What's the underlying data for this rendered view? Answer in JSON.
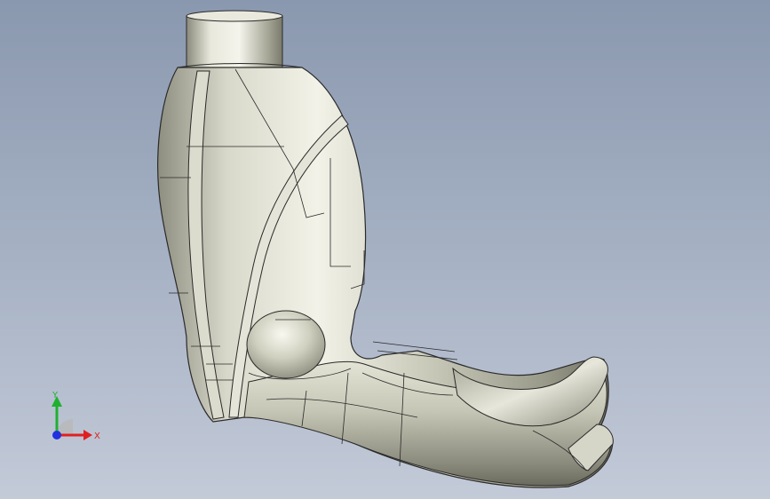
{
  "viewport": {
    "title": "",
    "background_top": "#8a98af",
    "background_bottom": "#c3cad8"
  },
  "model": {
    "name": "",
    "surface_color": "#cfcfc0",
    "edge_color": "#2a2a2a"
  },
  "triad": {
    "x_label": "X",
    "y_label": "Y",
    "x_color": "#e02020",
    "y_color": "#20b030",
    "z_color": "#2030e0"
  }
}
